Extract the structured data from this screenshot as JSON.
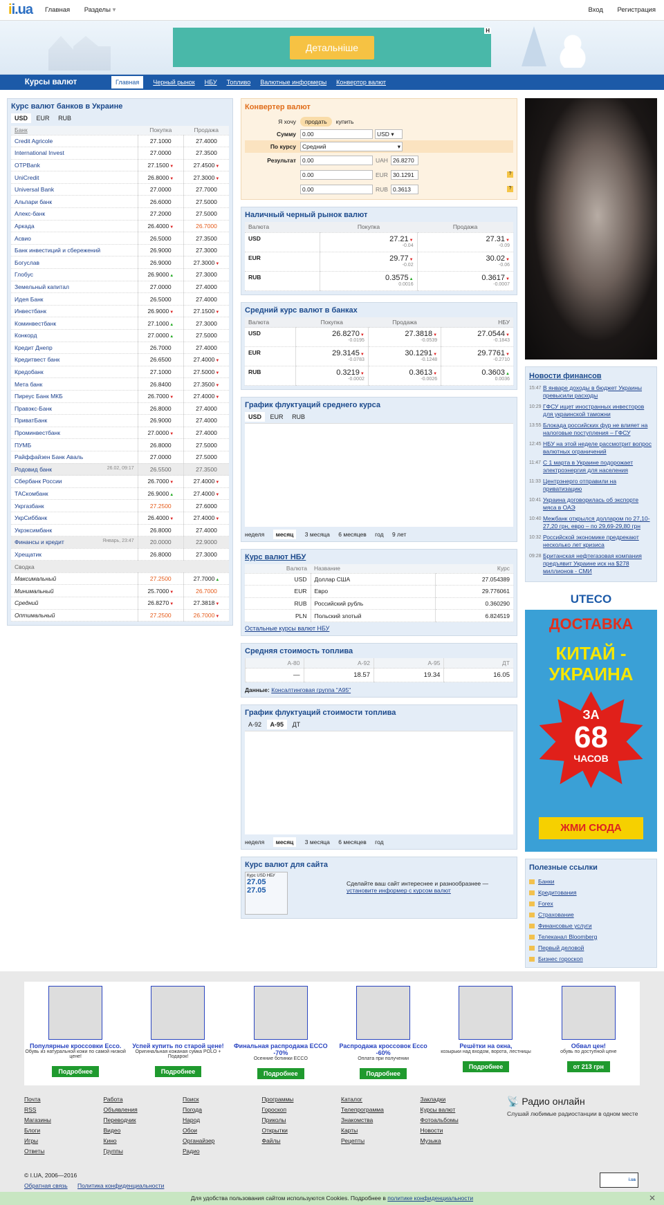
{
  "header": {
    "logo": "i.ua",
    "nav": [
      "Главная",
      "Разделы"
    ],
    "right": [
      "Вход",
      "Регистрация"
    ]
  },
  "banner": {
    "button": "Детальніше",
    "badge": "H"
  },
  "section": {
    "title": "Курсы валют",
    "tabs": [
      "Главная",
      "Черный рынок",
      "НБУ",
      "Топливо",
      "Валютные информеры",
      "Конвертор валют"
    ]
  },
  "banks": {
    "title": "Курс валют банков в Украине",
    "tabs": [
      "USD",
      "EUR",
      "RUB"
    ],
    "cols": [
      "Банк",
      "Покупка",
      "Продажа"
    ],
    "rows": [
      {
        "n": "Credit Agricole",
        "b": "27.1000",
        "s": "27.4000"
      },
      {
        "n": "International Invest",
        "b": "27.0000",
        "s": "27.3500"
      },
      {
        "n": "OTPBank",
        "b": "27.1500",
        "bd": "dn",
        "s": "27.4500",
        "sd": "dn"
      },
      {
        "n": "UniCredit",
        "b": "26.8000",
        "bd": "dn",
        "s": "27.3000",
        "sd": "dn"
      },
      {
        "n": "Universal Bank",
        "b": "27.0000",
        "s": "27.7000"
      },
      {
        "n": "Альпари банк",
        "b": "26.6000",
        "s": "27.5000"
      },
      {
        "n": "Алекс-банк",
        "b": "27.2000",
        "s": "27.5000"
      },
      {
        "n": "Аркада",
        "b": "26.4000",
        "bd": "dn",
        "s": "26.7000",
        "sr": true
      },
      {
        "n": "Асвио",
        "b": "26.5000",
        "s": "27.3500"
      },
      {
        "n": "Банк инвестиций и сбережений",
        "b": "26.9000",
        "s": "27.3000"
      },
      {
        "n": "Богуслав",
        "b": "26.9000",
        "s": "27.3000",
        "sd": "dn"
      },
      {
        "n": "Глобус",
        "b": "26.9000",
        "bd": "up",
        "s": "27.3000"
      },
      {
        "n": "Земельный капитал",
        "b": "27.0000",
        "s": "27.4000"
      },
      {
        "n": "Идея Банк",
        "b": "26.5000",
        "s": "27.4000"
      },
      {
        "n": "Инвестбанк",
        "b": "26.9000",
        "bd": "dn",
        "s": "27.1500",
        "sd": "dn"
      },
      {
        "n": "Коминвестбанк",
        "b": "27.1000",
        "bd": "up",
        "s": "27.3000"
      },
      {
        "n": "Конкорд",
        "b": "27.0000",
        "bd": "up",
        "s": "27.5000"
      },
      {
        "n": "Кредит Днепр",
        "b": "26.7000",
        "s": "27.4000"
      },
      {
        "n": "Кредитвест банк",
        "b": "26.6500",
        "s": "27.4000",
        "sd": "dn"
      },
      {
        "n": "Кредобанк",
        "b": "27.1000",
        "s": "27.5000",
        "sd": "dn"
      },
      {
        "n": "Мета банк",
        "b": "26.8400",
        "s": "27.3500",
        "sd": "dn"
      },
      {
        "n": "Пиреус Банк МКБ",
        "b": "26.7000",
        "bd": "dn",
        "s": "27.4000",
        "sd": "dn"
      },
      {
        "n": "Правэкс-Банк",
        "b": "26.8000",
        "s": "27.4000"
      },
      {
        "n": "ПриватБанк",
        "b": "26.9000",
        "s": "27.4000"
      },
      {
        "n": "Проминвестбанк",
        "b": "27.0000",
        "bd": "dn",
        "s": "27.4000"
      },
      {
        "n": "ПУМБ",
        "b": "26.8000",
        "s": "27.5000"
      },
      {
        "n": "Райффайзен Банк Аваль",
        "b": "27.0000",
        "s": "27.5000"
      },
      {
        "n": "Родовид банк",
        "date": "26.02, 09:17",
        "b": "26.5500",
        "s": "27.3500",
        "grey": true
      },
      {
        "n": "Сбербанк России",
        "b": "26.7000",
        "bd": "dn",
        "s": "27.4000",
        "sd": "dn"
      },
      {
        "n": "ТАСкомбанк",
        "b": "26.9000",
        "bd": "up",
        "s": "27.4000",
        "sd": "dn"
      },
      {
        "n": "Укргазбанк",
        "b": "27.2500",
        "br": true,
        "s": "27.6000"
      },
      {
        "n": "УкрСиббанк",
        "b": "26.4000",
        "bd": "dn",
        "s": "27.4000",
        "sd": "dn"
      },
      {
        "n": "Укрэксимбанк",
        "b": "26.8000",
        "s": "27.4000"
      },
      {
        "n": "Финансы и кредит",
        "date": "Январь, 23:47",
        "b": "20.0000",
        "s": "22.9000",
        "grey": true
      },
      {
        "n": "Хрещатик",
        "b": "26.8000",
        "s": "27.3000"
      }
    ],
    "summary_title": "Сводка",
    "summary": [
      {
        "n": "Максимальный",
        "b": "27.2500",
        "br": true,
        "s": "27.7000",
        "sd": "up"
      },
      {
        "n": "Минимальный",
        "b": "25.7000",
        "bd": "dn",
        "s": "26.7000",
        "sr": true
      },
      {
        "n": "Средний",
        "b": "26.8270",
        "bd": "dn",
        "s": "27.3818",
        "sd": "dn"
      },
      {
        "n": "Оптимальный",
        "b": "27.2500",
        "br": true,
        "s": "26.7000",
        "sd": "dn",
        "sr": true
      }
    ]
  },
  "converter": {
    "title": "Конвертер валют",
    "want": "Я хочу",
    "sell": "продать",
    "buy": "купить",
    "sum_label": "Сумму",
    "sum": "0.00",
    "cur": "USD",
    "rate_label": "По курсу",
    "rate": "Средний",
    "result_label": "Результат",
    "results": [
      {
        "v": "0.00",
        "c": "UAH",
        "r": "26.8270"
      },
      {
        "v": "0.00",
        "c": "EUR",
        "r": "30.1291"
      },
      {
        "v": "0.00",
        "c": "RUB",
        "r": "0.3613"
      }
    ]
  },
  "black": {
    "title": "Наличный черный рынок валют",
    "cols": [
      "Валюта",
      "Покупка",
      "Продажа"
    ],
    "rows": [
      {
        "c": "USD",
        "b": "27.21",
        "bd": "-0.04",
        "s": "27.31",
        "sd": "-0.09"
      },
      {
        "c": "EUR",
        "b": "29.77",
        "bd": "-0.02",
        "s": "30.02",
        "sd": "-0.06"
      },
      {
        "c": "RUB",
        "b": "0.3575",
        "bd": "0.0016",
        "s": "0.3617",
        "sd": "-0.0007"
      }
    ]
  },
  "avg": {
    "title": "Средний курс валют в банках",
    "cols": [
      "Валюта",
      "Покупка",
      "Продажа",
      "НБУ"
    ],
    "rows": [
      {
        "c": "USD",
        "b": "26.8270",
        "bd": "-0.0195",
        "s": "27.3818",
        "sd": "-0.0539",
        "n": "27.0544",
        "nd": "-0.1843"
      },
      {
        "c": "EUR",
        "b": "29.3145",
        "bd": "-0.0783",
        "s": "30.1291",
        "sd": "-0.1248",
        "n": "29.7761",
        "nd": "-0.2710"
      },
      {
        "c": "RUB",
        "b": "0.3219",
        "bd": "-0.0002",
        "s": "0.3613",
        "sd": "-0.0026",
        "n": "0.3603",
        "nd": "0.0036"
      }
    ]
  },
  "graph1": {
    "title": "График флуктуаций среднего курса",
    "tabs": [
      "USD",
      "EUR",
      "RUB"
    ],
    "periods": [
      "неделя",
      "месяц",
      "3 месяца",
      "6 месяцев",
      "год",
      "9 лет"
    ]
  },
  "nbu": {
    "title": "Курс валют НБУ",
    "cols": [
      "Валюта",
      "Название",
      "Курс"
    ],
    "rows": [
      {
        "c": "USD",
        "n": "Доллар США",
        "r": "27.054389"
      },
      {
        "c": "EUR",
        "n": "Евро",
        "r": "29.776061"
      },
      {
        "c": "RUB",
        "n": "Российский рубль",
        "r": "0.360290"
      },
      {
        "c": "PLN",
        "n": "Польский злотый",
        "r": "6.824519"
      }
    ],
    "link": "Остальные курсы валют НБУ"
  },
  "fuel": {
    "title": "Средняя стоимость топлива",
    "cols": [
      "А-80",
      "А-92",
      "А-95",
      "ДТ"
    ],
    "vals": [
      "—",
      "18.57",
      "19.34",
      "16.05"
    ],
    "src_label": "Данные:",
    "src": "Консалтинговая группа \"А95\""
  },
  "graph2": {
    "title": "График флуктуаций стоимости топлива",
    "tabs": [
      "А-92",
      "А-95",
      "ДТ"
    ],
    "periods": [
      "неделя",
      "месяц",
      "3 месяца",
      "6 месяцев",
      "год"
    ]
  },
  "informer": {
    "title": "Курс валют для сайта",
    "text": "Сделайте ваш сайт интереснее и разнообразнее —",
    "link": "установите информер с курсом валют",
    "img_title": "Курс USD НБУ",
    "v1": "27.05",
    "v2": "27.05"
  },
  "news": {
    "title": "Новости финансов",
    "items": [
      {
        "t": "15:47",
        "h": "В январе доходы в бюджет Украины превысили расходы"
      },
      {
        "t": "10:29",
        "h": "ГФСУ ищет иностранных инвесторов для украинской таможни"
      },
      {
        "t": "13:55",
        "h": "Блокада российских фур не влияет на налоговые поступления – ГФСУ"
      },
      {
        "t": "12:45",
        "h": "НБУ на этой неделе рассмотрит вопрос валютных ограничений"
      },
      {
        "t": "11:47",
        "h": "С 1 марта в Украине подорожает электроэнергия для населения"
      },
      {
        "t": "11:33",
        "h": "Центрэнерго отправили на приватизацию"
      },
      {
        "t": "10:41",
        "h": "Украина договорилась об экспорте мяса в ОАЭ"
      },
      {
        "t": "10:40",
        "h": "Межбанк открылся долларом по 27,10-27,20 грн, евро – по 29,69-29,80 грн"
      },
      {
        "t": "10:32",
        "h": "Российской экономике предрекают несколько лет кризиса"
      },
      {
        "t": "09:28",
        "h": "Британская нефтегазовая компания предъявит Украине иск на $278 миллионов - СМИ"
      }
    ]
  },
  "promo": {
    "logo": "UTECO",
    "l1": "ДОСТАВКА",
    "l2": "КИТАЙ - УКРАИНА",
    "za": "ЗА",
    "num": "68",
    "hr": "ЧАСОВ",
    "go": "ЖМИ СЮДА"
  },
  "links": {
    "title": "Полезные ссылки",
    "items": [
      "Банки",
      "Кредитования",
      "Forex",
      "Страхование",
      "Финансовые услуги",
      "Телеканал Bloomberg",
      "Первый деловой",
      "Бизнес гороскоп"
    ]
  },
  "ads": [
    {
      "h": "Популярные кроссовки Ecco.",
      "s": "Обувь из натуральной кожи по самой низкой цене!",
      "b": "Подробнее"
    },
    {
      "h": "Успей купить по старой цене!",
      "s": "Оригинальная кожаная сумка POLO + Подарок!",
      "b": "Подробнее"
    },
    {
      "h": "Финальная распродажа ECCO -70%",
      "s": "Осенние ботинки ECCO",
      "b": "Подробнее"
    },
    {
      "h": "Распродажа кроссовок Ecco -60%",
      "s": "Оплата при получении",
      "b": "Подробнее"
    },
    {
      "h": "Решётки на окна,",
      "s": "козырьки над входом, ворота, лестницы",
      "b": "Подробнее"
    },
    {
      "h": "Обвал цен!",
      "s": "обувь по доступной цене",
      "b": "от 213 грн"
    }
  ],
  "footer": {
    "cols": [
      [
        "Почта",
        "RSS",
        "Магазины",
        "Блоги",
        "Игры",
        "Ответы"
      ],
      [
        "Работа",
        "Объявления",
        "Переводчик",
        "Видео",
        "Кино",
        "Группы"
      ],
      [
        "Поиск",
        "Погода",
        "Народ",
        "Обои",
        "Органайзер",
        "Радио"
      ],
      [
        "Программы",
        "Гороскоп",
        "Приколы",
        "Открытки",
        "Файлы"
      ],
      [
        "Каталог",
        "Телепрограмма",
        "Знакомства",
        "Карты",
        "Рецепты"
      ],
      [
        "Закладки",
        "Курсы валют",
        "Фотоальбомы",
        "Новости",
        "Музыка"
      ]
    ],
    "radio_title": "Радио онлайн",
    "radio_text": "Слушай любимые радиостанции в одном месте",
    "copy": "© I.UA, 2006—2016",
    "feedback": "Обратная связь",
    "privacy": "Политика конфиденциальности",
    "counter": "i.ua"
  },
  "cookie": {
    "text": "Для удобства пользования сайтом используются Cookies. Подробнее в",
    "link": "политике конфиденциальности"
  }
}
